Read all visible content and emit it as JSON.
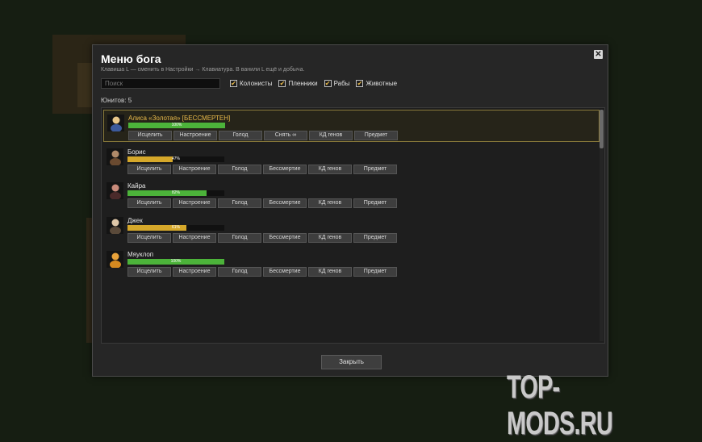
{
  "dialog": {
    "title": "Меню бога",
    "subtitle": "Клавиша L — сменить в Настройки → Клавиатура. В ванили L ещё и добыча.",
    "search_placeholder": "Поиск",
    "filters": [
      "Колонисты",
      "Пленники",
      "Рабы",
      "Животные"
    ],
    "count": "Юнитов: 5",
    "close_label": "Закрыть"
  },
  "pawns": [
    {
      "name": "Алиса «Золотая»  [БЕССМЕРТЕН]",
      "pct_label": "100%",
      "pct": 100,
      "bar_color": "#4cb33a",
      "head": "#e8c78a",
      "body": "#3c5a9c",
      "selected": true,
      "buttons": [
        "Исцелить",
        "Настроение",
        "Голод",
        "Снять ∞",
        "КД генов",
        "Предмет"
      ]
    },
    {
      "name": "Борис",
      "pct_label": "47%",
      "pct": 47,
      "bar_color": "#d6a82a",
      "head": "#b08a6a",
      "body": "#6a4a30",
      "selected": false,
      "buttons": [
        "Исцелить",
        "Настроение",
        "Голод",
        "Бессмертие",
        "КД генов",
        "Предмет"
      ]
    },
    {
      "name": "Кайра",
      "pct_label": "82%",
      "pct": 82,
      "bar_color": "#4cb33a",
      "head": "#c88a7a",
      "body": "#4a2a2a",
      "selected": false,
      "buttons": [
        "Исцелить",
        "Настроение",
        "Голод",
        "Бессмертие",
        "КД генов",
        "Предмет"
      ]
    },
    {
      "name": "Джек",
      "pct_label": "61%",
      "pct": 61,
      "bar_color": "#d6a82a",
      "head": "#e0c8a8",
      "body": "#5a4a3a",
      "selected": false,
      "buttons": [
        "Исцелить",
        "Настроение",
        "Голод",
        "Бессмертие",
        "КД генов",
        "Предмет"
      ]
    },
    {
      "name": "Мяуклоп",
      "pct_label": "100%",
      "pct": 100,
      "bar_color": "#4cb33a",
      "head": "#e8a23a",
      "body": "#d68a20",
      "selected": false,
      "buttons": [
        "Исцелить",
        "Настроение",
        "Голод",
        "Бессмертие",
        "КД генов",
        "Предмет"
      ]
    }
  ],
  "watermark": "TOP-MODS.RU",
  "icons": {
    "close": "close-icon",
    "check": "checkmark-icon",
    "avatar": "pawn-portrait-icon"
  }
}
